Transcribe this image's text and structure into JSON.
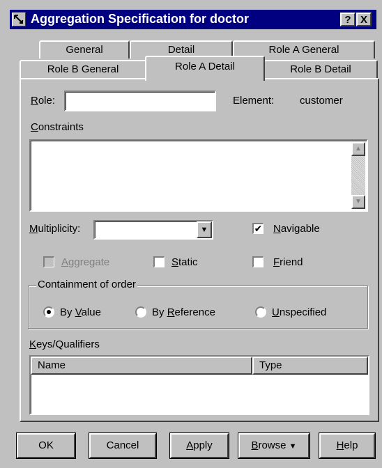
{
  "window": {
    "title": "Aggregation Specification for doctor"
  },
  "title_buttons": {
    "help": "?",
    "close": "X"
  },
  "tabs": {
    "row1": [
      "General",
      "Detail",
      "Role A General"
    ],
    "row2": [
      "Role B General",
      "Role A Detail",
      "Role B Detail"
    ],
    "active": "Role A Detail"
  },
  "role": {
    "label_u": "R",
    "label_rest": "ole:",
    "value": ""
  },
  "element": {
    "label": "Element:",
    "value": "customer"
  },
  "constraints": {
    "label_u": "C",
    "label_rest": "onstraints",
    "value": ""
  },
  "multiplicity": {
    "label_u": "M",
    "label_rest": "ultiplicity:",
    "value": ""
  },
  "navigable": {
    "label_u": "N",
    "label_rest": "avigable",
    "checked": true
  },
  "aggregate": {
    "label_u": "A",
    "label_rest": "ggregate",
    "checked": false,
    "enabled": false
  },
  "static": {
    "label_u": "S",
    "label_rest": "tatic",
    "checked": false
  },
  "friend": {
    "label_u": "F",
    "label_rest": "riend",
    "checked": false
  },
  "containment": {
    "legend": "Containment of order",
    "options": [
      {
        "pre": "By ",
        "u": "V",
        "post": "alue",
        "selected": true
      },
      {
        "pre": "By ",
        "u": "R",
        "post": "eference",
        "selected": false
      },
      {
        "pre": "",
        "u": "U",
        "post": "nspecified",
        "selected": false
      }
    ]
  },
  "keys": {
    "label_u": "K",
    "label_rest": "eys/Qualifiers",
    "columns": [
      "Name",
      "Type"
    ],
    "rows": []
  },
  "buttons": {
    "ok": "OK",
    "cancel": "Cancel",
    "apply_u": "A",
    "apply_rest": "pply",
    "browse_u": "B",
    "browse_rest": "rowse",
    "help_u": "H",
    "help_rest": "elp"
  },
  "icons": {
    "arrow_down": "▼",
    "arrow_up": "▲",
    "check": "✔"
  },
  "colors": {
    "titlebar": "#000080",
    "face": "#c0c0c0"
  }
}
